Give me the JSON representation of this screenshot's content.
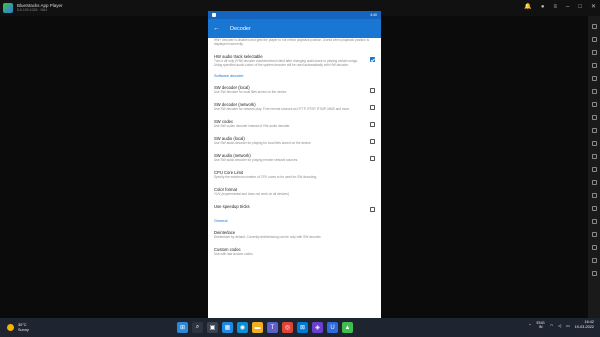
{
  "window": {
    "title": "BlueStacks App Player",
    "subtitle": "5.6.100.1026 · N64",
    "controls": [
      "bell-icon",
      "account-icon",
      "menu-icon",
      "minimize-icon",
      "maximize-icon",
      "close-icon"
    ]
  },
  "android": {
    "time": "4:40",
    "appbar_title": "Decoder",
    "top_cutoff_text": "HW+ decoder is disabled and gets the player to not reflect playback position. Useful when playback position is displayed incorrectly.",
    "items_top": [
      {
        "title": "HW audio track selectable",
        "summary": "Turn it off only if HW decoder crashes/mixed client after changing audio track or playing certain songs. Using specified audio codec of the system decoder will be used automatically with HW decoder.",
        "checked": true
      }
    ],
    "section_software": "Software decoder",
    "items_software": [
      {
        "title": "SW decoder (local)",
        "summary": "Use SW decoder for local files stored on the device.",
        "checkbox": true,
        "checked": false
      },
      {
        "title": "SW decoder (network)",
        "summary": "Use SW decoder for network play. Fore remote sources as HTTP, RTSP, RTMP, MMS and more.",
        "checkbox": true,
        "checked": false
      },
      {
        "title": "SW codec",
        "summary": "Use SW codec decoder instead of HW audio decoder.",
        "checkbox": true,
        "checked": false
      },
      {
        "title": "SW audio (local)",
        "summary": "Use SW audio decoder for playing for local files stored on the device.",
        "checkbox": true,
        "checked": false
      },
      {
        "title": "SW audio (network)",
        "summary": "Use SW audio decoder for playing remote network sources.",
        "checkbox": true,
        "checked": false
      },
      {
        "title": "CPU Core Limit",
        "summary": "Specify the maximum number of CPU cores to be used for SW decoding.",
        "checkbox": false
      },
      {
        "title": "Color format",
        "summary": "YUV (experimental and does not work on all devices)",
        "checkbox": false
      },
      {
        "title": "Use speedup tricks",
        "summary": "",
        "checkbox": true,
        "checked": false
      }
    ],
    "section_general": "General",
    "items_general": [
      {
        "title": "Deinterlace",
        "summary": "Deinterlace by default. Currently deinterlacing can be only with SW decoder.",
        "checkbox": false
      },
      {
        "title": "Custom codec",
        "summary": "Use with last custom codec.",
        "checkbox": false
      }
    ]
  },
  "taskbar": {
    "temp": "30°C",
    "weather": "Sunny",
    "lang_top": "ENG",
    "lang_bottom": "IN",
    "time": "16:42",
    "date": "19-03-2022",
    "apps": [
      {
        "name": "windows-start-icon",
        "color": "#2b88d8",
        "glyph": "⊞"
      },
      {
        "name": "search-icon",
        "color": "#2e3440",
        "glyph": "⌕"
      },
      {
        "name": "task-view-icon",
        "color": "#3b4252",
        "glyph": "▣"
      },
      {
        "name": "widgets-icon",
        "color": "#1e88e5",
        "glyph": "▦"
      },
      {
        "name": "edge-icon",
        "color": "#0c8fd6",
        "glyph": "◉"
      },
      {
        "name": "file-explorer-icon",
        "color": "#f2b01e",
        "glyph": "▬"
      },
      {
        "name": "teams-icon",
        "color": "#5b5fc7",
        "glyph": "T"
      },
      {
        "name": "chrome-icon",
        "color": "#db4437",
        "glyph": "◎"
      },
      {
        "name": "store-icon",
        "color": "#0078d4",
        "glyph": "⊠"
      },
      {
        "name": "photos-icon",
        "color": "#6a3fd0",
        "glyph": "◈"
      },
      {
        "name": "ubisoft-icon",
        "color": "#2f6bdb",
        "glyph": "U"
      },
      {
        "name": "bluestacks-icon",
        "color": "#3fbf4f",
        "glyph": "▲"
      }
    ]
  }
}
